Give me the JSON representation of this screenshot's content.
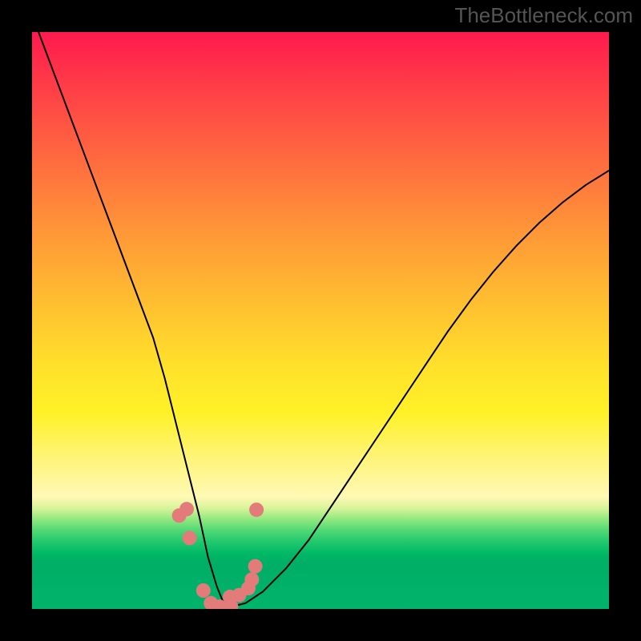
{
  "watermark": "TheBottleneck.com",
  "chart_data": {
    "type": "line",
    "title": "",
    "xlabel": "",
    "ylabel": "",
    "xlim": [
      0,
      100
    ],
    "ylim": [
      0,
      100
    ],
    "background_gradient": {
      "stops": [
        {
          "pos": 0,
          "color": "#ff1a4e",
          "label": "top-red"
        },
        {
          "pos": 0.66,
          "color": "#fff127",
          "label": "mid-yellow"
        },
        {
          "pos": 1.0,
          "color": "#00b46c",
          "label": "bottom-green"
        }
      ]
    },
    "series": [
      {
        "name": "bottleneck-curve",
        "x": [
          0,
          3,
          6,
          9,
          12,
          15,
          18,
          21,
          23,
          25,
          27,
          29,
          30.5,
          32,
          33,
          34,
          35,
          37,
          40,
          44,
          48,
          52,
          56,
          60,
          64,
          68,
          72,
          76,
          80,
          84,
          88,
          92,
          96,
          100
        ],
        "y": [
          103,
          95,
          87,
          79,
          71,
          63,
          55,
          47,
          40,
          32,
          24,
          16,
          9,
          4,
          1.5,
          0.5,
          0.5,
          1,
          3,
          7,
          12,
          18,
          24,
          30,
          36,
          42,
          48,
          53.5,
          58.5,
          63,
          67,
          70.5,
          73.5,
          76
        ],
        "note": "y=0 is bottom (green), y=100 is top (red); left branch descends steeply from off-top to the trough near x≈33, right branch rises with decreasing slope"
      }
    ],
    "markers": [
      {
        "x": 25.5,
        "y": 16.2
      },
      {
        "x": 26.8,
        "y": 17.3
      },
      {
        "x": 27.3,
        "y": 12.3
      },
      {
        "x": 29.7,
        "y": 3.2
      },
      {
        "x": 31.0,
        "y": 1.0
      },
      {
        "x": 32.5,
        "y": 0.4
      },
      {
        "x": 34.5,
        "y": 0.4
      },
      {
        "x": 34.3,
        "y": 2.1
      },
      {
        "x": 35.9,
        "y": 2.4
      },
      {
        "x": 37.5,
        "y": 3.6
      },
      {
        "x": 38.1,
        "y": 5.1
      },
      {
        "x": 38.7,
        "y": 7.4
      },
      {
        "x": 38.9,
        "y": 17.2
      }
    ],
    "marker_style": {
      "color": "#e47b7b",
      "radius_px": 9
    }
  }
}
